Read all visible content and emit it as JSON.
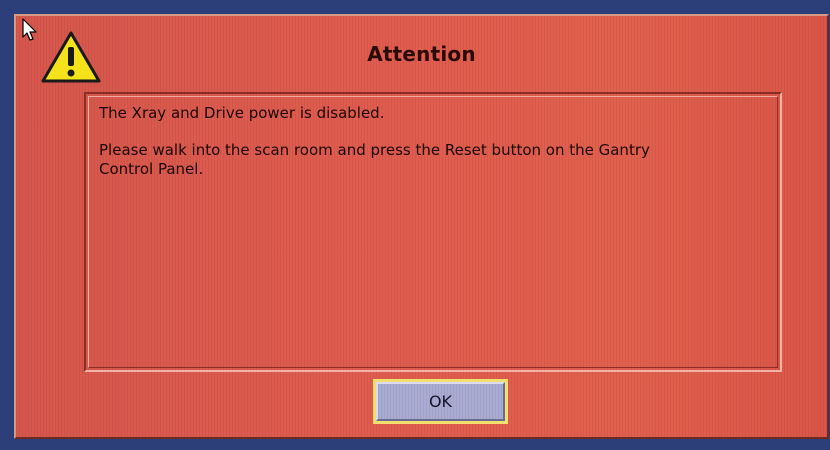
{
  "dialog": {
    "title": "Attention",
    "icon": "warning-icon",
    "message_line_1": "The Xray and Drive power is disabled.",
    "message_line_2": "Please walk into the scan room and press the Reset button on the Gantry Control Panel.",
    "ok_label": "OK"
  },
  "colors": {
    "dialog_background": "#e05c4f",
    "button_face": "#a9abd2",
    "button_focus_ring": "#f1e06e",
    "warning_yellow": "#f4e21a",
    "desktop_background": "#2c3f78"
  }
}
